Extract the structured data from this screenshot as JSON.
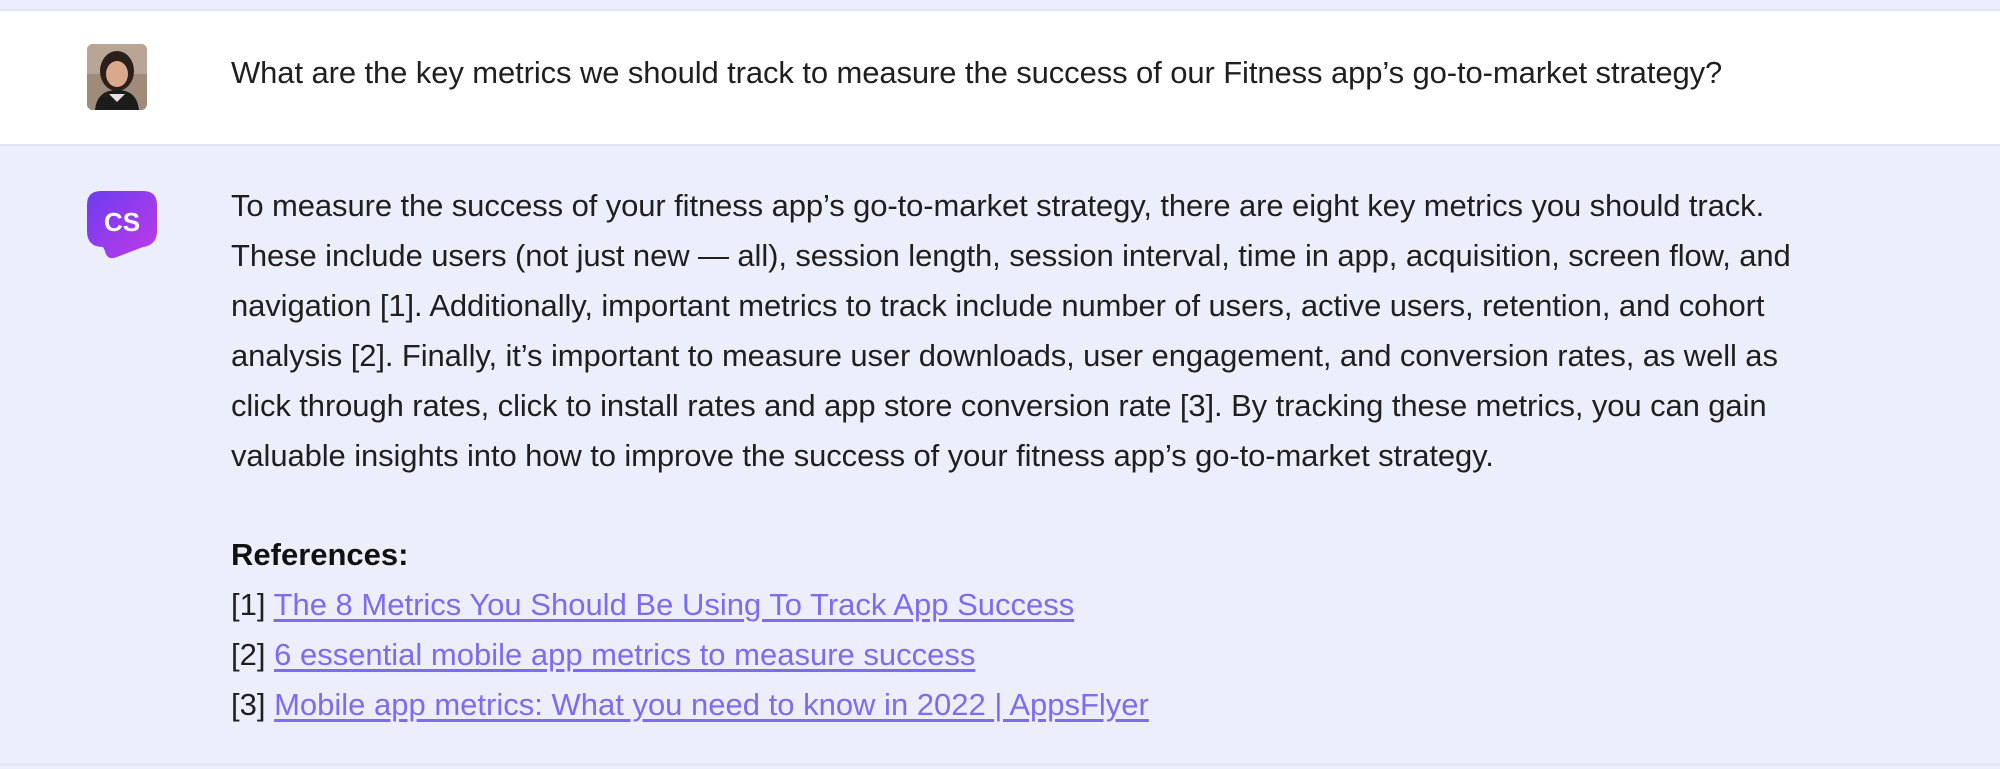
{
  "question": {
    "text": "What are the key metrics we should track to measure the success of our Fitness app’s go-to-market strategy?"
  },
  "answer": {
    "logo_text": "CS",
    "lines": [
      "To measure the success of your fitness app’s go-to-market strategy, there are eight key metrics you should track.",
      "These include users (not just new — all), session length, session interval, time in app, acquisition, screen flow, and",
      "navigation [1]. Additionally, important metrics to track include number of users, active users, retention, and cohort",
      "analysis [2]. Finally, it’s important to measure user downloads, user engagement, and conversion rates, as well as",
      "click through rates, click to install rates and app store conversion rate [3]. By tracking these metrics, you can gain",
      "valuable insights into how to improve the success of your fitness app’s go-to-market strategy."
    ],
    "references_heading": "References:",
    "references": [
      {
        "num": "[1]",
        "title": "The 8 Metrics You Should Be Using To Track App Success"
      },
      {
        "num": "[2]",
        "title": "6 essential mobile app metrics to measure success"
      },
      {
        "num": "[3]",
        "title": "Mobile app metrics: What you need to know in 2022 | AppsFlyer"
      }
    ]
  },
  "colors": {
    "link": "#7b6cf0",
    "bot_background": "#eceffb",
    "user_background": "#ffffff",
    "logo_gradient_start": "#6a3cf0",
    "logo_gradient_end": "#c23be6"
  },
  "icons": {
    "user_avatar": "user-avatar-photo",
    "bot_logo": "cs-logo-icon"
  }
}
